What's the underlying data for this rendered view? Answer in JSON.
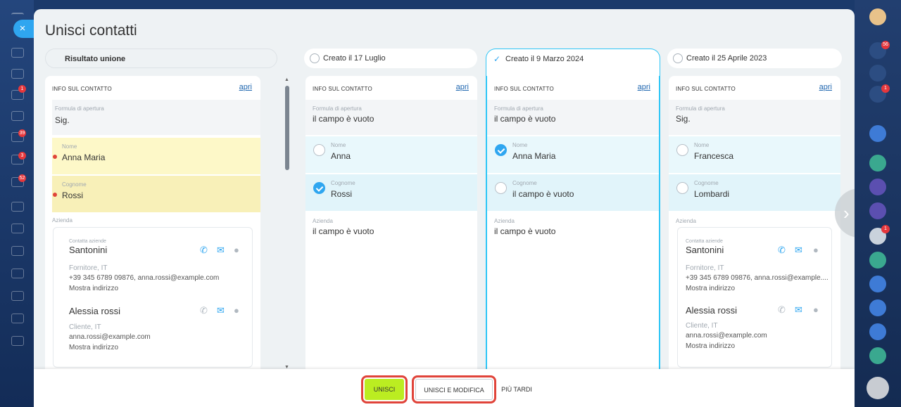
{
  "modal": {
    "title": "Unisci contatti",
    "close_icon": "×"
  },
  "result_column": {
    "pill_label": "Risultato unione",
    "section_header": "INFO SUL CONTATTO",
    "open_link": "apri",
    "formula_label": "Formula di apertura",
    "formula_value": "Sig.",
    "name_label": "Nome",
    "name_value": "Anna Maria",
    "surname_label": "Cognome",
    "surname_value": "Rossi",
    "company_label": "Azienda",
    "company_card": {
      "contacts_label": "Contatta aziende",
      "company_name": "Santonini",
      "role": "Fornitore, IT",
      "contact_line": "+39 345 6789 09876, anna.rossi@example.com",
      "address_link": "Mostra indirizzo",
      "person_name": "Alessia rossi",
      "person_role": "Cliente, IT",
      "person_email": "anna.rossi@example.com",
      "person_address_link": "Mostra indirizzo"
    }
  },
  "source_columns": [
    {
      "pill_label": "Creato il 17 Luglio",
      "section_header": "INFO SUL CONTATTO",
      "open_link": "apri",
      "formula_label": "Formula di apertura",
      "formula_value": "il campo è vuoto",
      "name_label": "Nome",
      "name_value": "Anna",
      "surname_label": "Cognome",
      "surname_value": "Rossi",
      "company_label": "Azienda",
      "company_value": "il campo è vuoto"
    },
    {
      "pill_label": "Creato il 9 Marzo 2024",
      "section_header": "INFO SUL CONTATTO",
      "open_link": "apri",
      "formula_label": "Formula di apertura",
      "formula_value": "il campo è vuoto",
      "name_label": "Nome",
      "name_value": "Anna Maria",
      "surname_label": "Cognome",
      "surname_value": "il campo è vuoto",
      "company_label": "Azienda",
      "company_value": "il campo è vuoto"
    },
    {
      "pill_label": "Creato il 25 Aprile 2023",
      "section_header": "INFO SUL CONTATTO",
      "open_link": "apri",
      "formula_label": "Formula di apertura",
      "formula_value": "Sig.",
      "name_label": "Nome",
      "name_value": "Francesca",
      "surname_label": "Cognome",
      "surname_value": "Lombardi",
      "company_label": "Azienda",
      "company_card": {
        "contacts_label": "Contatta aziende",
        "company_name": "Santonini",
        "role": "Fornitore, IT",
        "contact_line": "+39 345 6789 09876, anna.rossi@example....",
        "address_link": "Mostra indirizzo",
        "person_name": "Alessia rossi",
        "person_role": "Cliente, IT",
        "person_email": "anna.rossi@example.com",
        "person_address_link": "Mostra indirizzo"
      }
    }
  ],
  "footer": {
    "merge_label": "UNISCI",
    "merge_edit_label": "UNISCI E MODIFICA",
    "later_label": "PIÙ TARDI"
  },
  "right_rail": {
    "notifications_badge": "56",
    "badge_1": "1",
    "badge_2": "1"
  },
  "left_nav": {
    "badges": [
      "1",
      "39",
      "3",
      "52"
    ]
  },
  "colors": {
    "accent": "#2fc6f6",
    "merge_button": "#bbed21",
    "highlight": "#e0443a",
    "result_highlight": "#fdf8c8",
    "selected_row": "#e5f7fc"
  }
}
